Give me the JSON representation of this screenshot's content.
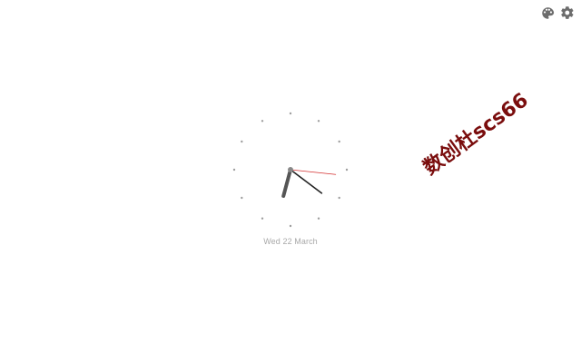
{
  "toolbar": {
    "theme_icon": "palette-icon",
    "settings_icon": "gear-icon"
  },
  "clock": {
    "hour": 7,
    "minute": 24,
    "second": 16,
    "colors": {
      "hour_hand": "#555555",
      "minute_hand": "#222222",
      "second_hand": "#d32f2f",
      "marks": "#9e9e9e",
      "center": "#888888"
    }
  },
  "date": {
    "text": "Wed 22 March",
    "color": "#a8a8a8"
  },
  "watermark": {
    "text": "数创杜scs66",
    "color": "#7a0d0d"
  }
}
